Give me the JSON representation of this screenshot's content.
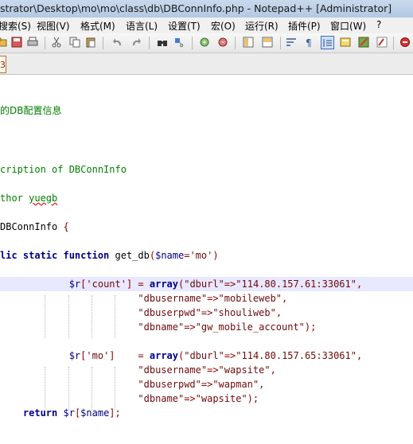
{
  "window": {
    "title": "strator\\Desktop\\mo\\mo\\class\\db\\DBConnInfo.php - Notepad++ [Administrator]"
  },
  "menu": {
    "items": [
      {
        "id": "search",
        "label": "搜索(S)"
      },
      {
        "id": "view",
        "label": "视图(V)"
      },
      {
        "id": "format",
        "label": "格式(M)"
      },
      {
        "id": "language",
        "label": "语言(L)"
      },
      {
        "id": "settings",
        "label": "设置(T)"
      },
      {
        "id": "macro",
        "label": "宏(O)"
      },
      {
        "id": "run",
        "label": "运行(R)"
      },
      {
        "id": "plugins",
        "label": "插件(P)"
      },
      {
        "id": "window",
        "label": "窗口(W)"
      },
      {
        "id": "help",
        "label": "?"
      }
    ]
  },
  "toolbar": {
    "icons": [
      "open-file-icon",
      "save-icon",
      "print-icon",
      "cut-icon",
      "copy-icon",
      "paste-icon",
      "undo-icon",
      "redo-icon",
      "find-icon",
      "replace-icon",
      "zoom-in-icon",
      "zoom-out-icon",
      "sync-vertical-icon",
      "sync-horizontal-icon",
      "word-wrap-icon",
      "show-all-chars-icon",
      "indent-guide-icon",
      "user-lang-icon",
      "doc-map-icon",
      "record-macro-icon",
      "stop-record-icon"
    ],
    "active": "indent-guide-icon"
  },
  "tab": {
    "label": "3"
  },
  "editor": {
    "current_line_index": 8,
    "lines": [
      "",
      "",
      "",
      "",
      "",
      "",
      "",
      "",
      "",
      "",
      "",
      "",
      "",
      "",
      "",
      "",
      "",
      "",
      "",
      "",
      "",
      ""
    ],
    "code": {
      "l1": "的DB配置信息",
      "l2a": "cription of ",
      "l2b": "DBConnInfo",
      "l3a": "thor ",
      "l3b": "yuegb",
      "l4a": "DBConnInfo ",
      "l4b": "{",
      "l5a": "lic static function ",
      "l5b": "get_db",
      "l5c": "(",
      "l5d": "$name",
      "l5e": "=",
      "l5f": "'mo'",
      "l5g": ")",
      "l6a": "$r",
      "l6b": "[",
      "l6c": "'count'",
      "l6d": "] = ",
      "l6e": "array",
      "l6f": "(",
      "l6g": "\"dburl\"",
      "l6h": "=>",
      "l6i": "\"114.80.157.61:33061\"",
      "l6j": ",",
      "l7a": "\"dbusername\"",
      "l7b": "=>",
      "l7c": "\"mobileweb\"",
      "l7d": ",",
      "l8a": "\"dbuserpwd\"",
      "l8b": "=>",
      "l8c": "\"shouliweb\"",
      "l8d": ",",
      "l9a": "\"dbname\"",
      "l9b": "=>",
      "l9c": "\"gw_mobile_account\"",
      "l9d": ");",
      "l10a": "$r",
      "l10b": "[",
      "l10c": "'mo'",
      "l10d": "]    = ",
      "l10e": "array",
      "l10f": "(",
      "l10g": "\"dburl\"",
      "l10h": "=>",
      "l10i": "\"114.80.157.65:33061\"",
      "l10j": ",",
      "l11a": "\"dbusername\"",
      "l11b": "=>",
      "l11c": "\"wapsite\"",
      "l11d": ",",
      "l12a": "\"dbuserpwd\"",
      "l12b": "=>",
      "l12c": "\"wapman\"",
      "l12d": ",",
      "l13a": "\"dbname\"",
      "l13b": "=>",
      "l13c": "\"wapsite\"",
      "l13d": ");",
      "l14a": "return ",
      "l14b": "$r",
      "l14c": "[",
      "l14d": "$name",
      "l14e": "];"
    }
  }
}
